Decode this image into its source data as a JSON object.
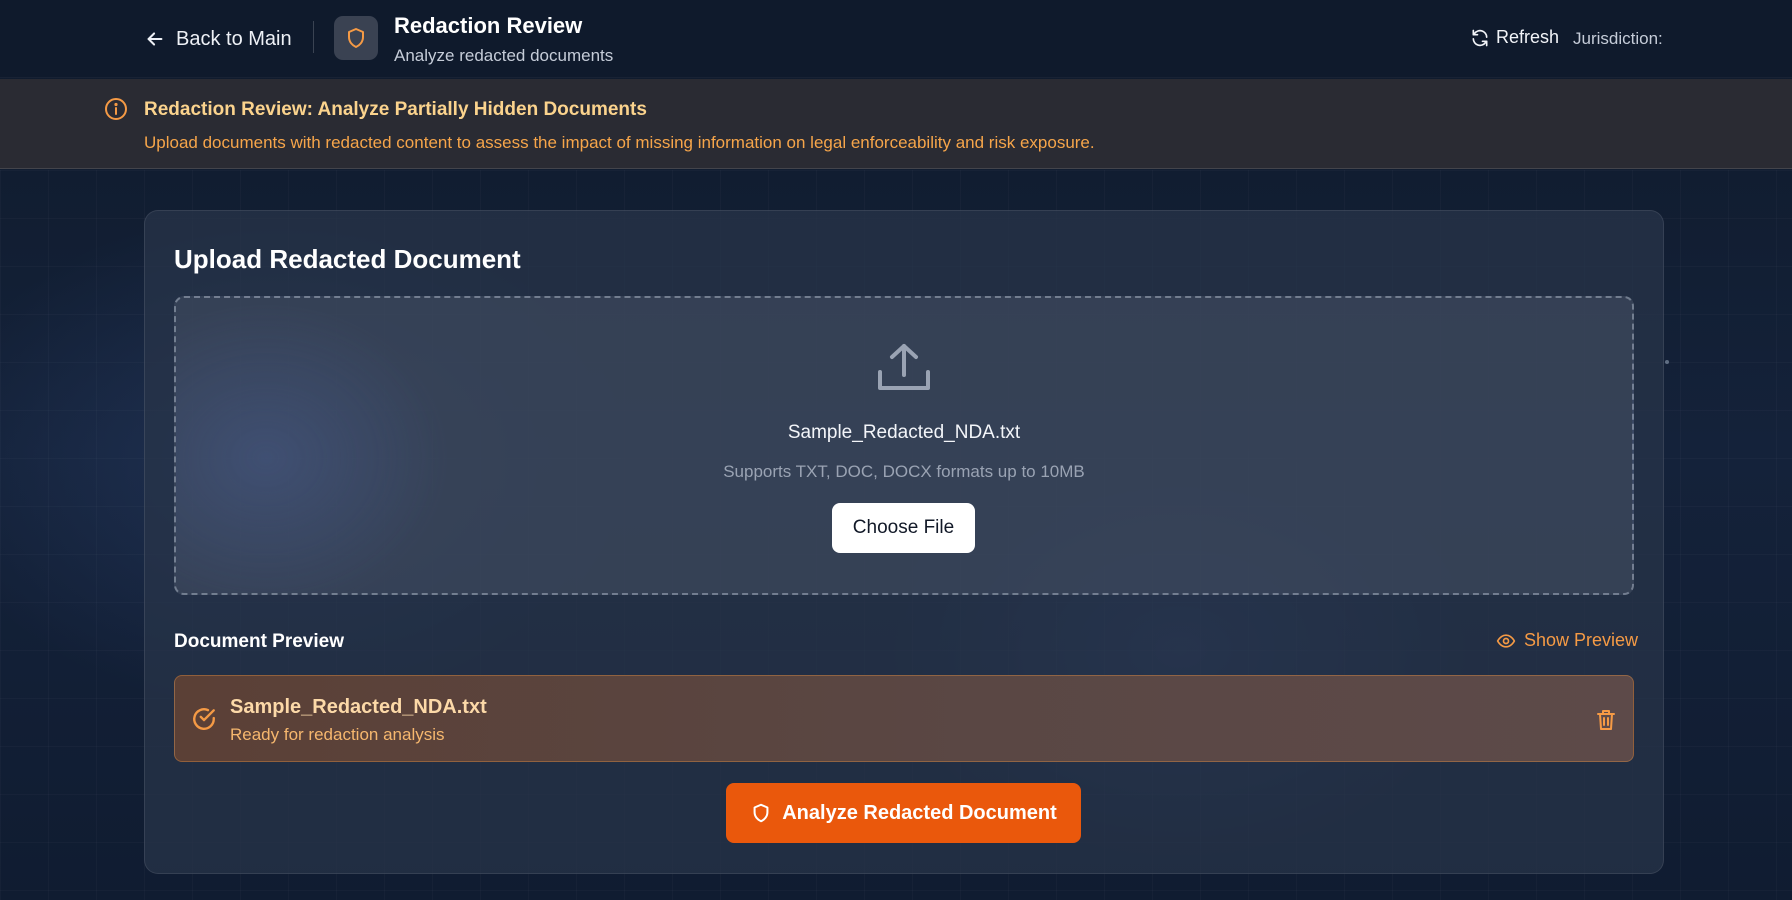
{
  "header": {
    "back_label": "Back to Main",
    "title": "Redaction Review",
    "subtitle": "Analyze redacted documents",
    "refresh_label": "Refresh",
    "jurisdiction_label": "Jurisdiction:"
  },
  "banner": {
    "title": "Redaction Review: Analyze Partially Hidden Documents",
    "text": "Upload documents with redacted content to assess the impact of missing information on legal enforceability and risk exposure."
  },
  "upload": {
    "title": "Upload Redacted Document",
    "file_name": "Sample_Redacted_NDA.txt",
    "formats": "Supports TXT, DOC, DOCX formats up to 10MB",
    "choose_label": "Choose File"
  },
  "preview": {
    "label": "Document Preview",
    "show_label": "Show Preview",
    "file_name": "Sample_Redacted_NDA.txt",
    "status": "Ready for redaction analysis"
  },
  "actions": {
    "analyze_label": "Analyze Redacted Document"
  },
  "colors": {
    "accent": "#ea580c",
    "warning_text": "#f6a54a",
    "background": "#0f1a2c"
  },
  "icons": {
    "back": "arrow-left-icon",
    "app": "shield-icon",
    "refresh": "refresh-icon",
    "info": "info-icon",
    "upload": "upload-icon",
    "eye": "eye-icon",
    "check": "check-circle-icon",
    "trash": "trash-icon"
  }
}
